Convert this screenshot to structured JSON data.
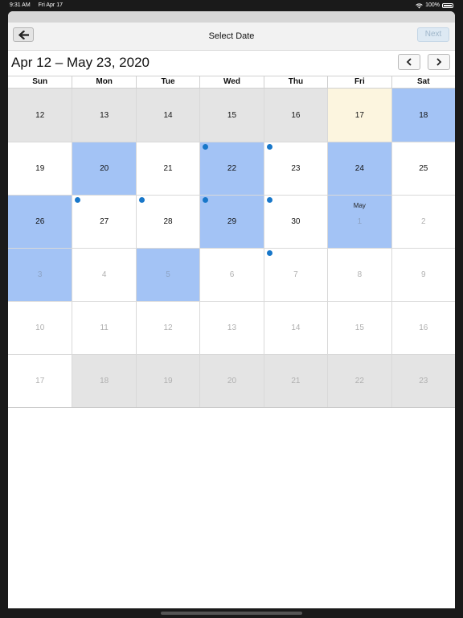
{
  "status_bar": {
    "time": "9:31 AM",
    "date": "Fri Apr 17",
    "battery": "100%",
    "icons": [
      "wifi-icon",
      "battery-icon"
    ]
  },
  "nav": {
    "title": "Select Date",
    "next_label": "Next",
    "back_icon": "arrow-left-icon"
  },
  "header": {
    "range_title": "Apr 12 – May 23, 2020",
    "prev_icon": "chevron-left-icon",
    "next_icon": "chevron-right-icon"
  },
  "weekdays": [
    "Sun",
    "Mon",
    "Tue",
    "Wed",
    "Thu",
    "Fri",
    "Sat"
  ],
  "colors": {
    "selected": "#a3c3f5",
    "past": "#e4e4e4",
    "today": "#fcf5df",
    "event_dot": "#1877c9"
  },
  "days": [
    {
      "label": "12",
      "state": "past"
    },
    {
      "label": "13",
      "state": "past"
    },
    {
      "label": "14",
      "state": "past"
    },
    {
      "label": "15",
      "state": "past"
    },
    {
      "label": "16",
      "state": "past"
    },
    {
      "label": "17",
      "state": "today"
    },
    {
      "label": "18",
      "state": "selected"
    },
    {
      "label": "19",
      "state": "normal"
    },
    {
      "label": "20",
      "state": "selected"
    },
    {
      "label": "21",
      "state": "normal"
    },
    {
      "label": "22",
      "state": "selected",
      "dot": true
    },
    {
      "label": "23",
      "state": "normal",
      "dot": true
    },
    {
      "label": "24",
      "state": "selected"
    },
    {
      "label": "25",
      "state": "normal"
    },
    {
      "label": "26",
      "state": "selected"
    },
    {
      "label": "27",
      "state": "normal",
      "dot": true
    },
    {
      "label": "28",
      "state": "normal",
      "dot": true
    },
    {
      "label": "29",
      "state": "selected",
      "dot": true
    },
    {
      "label": "30",
      "state": "normal",
      "dot": true
    },
    {
      "label": "1",
      "state": "selected",
      "muted": true,
      "month": "May"
    },
    {
      "label": "2",
      "state": "normal",
      "muted": true
    },
    {
      "label": "3",
      "state": "selected",
      "muted": true
    },
    {
      "label": "4",
      "state": "normal",
      "muted": true
    },
    {
      "label": "5",
      "state": "selected",
      "muted": true
    },
    {
      "label": "6",
      "state": "normal",
      "muted": true
    },
    {
      "label": "7",
      "state": "normal",
      "muted": true,
      "dot": true
    },
    {
      "label": "8",
      "state": "normal",
      "muted": true
    },
    {
      "label": "9",
      "state": "normal",
      "muted": true
    },
    {
      "label": "10",
      "state": "normal",
      "muted": true
    },
    {
      "label": "11",
      "state": "normal",
      "muted": true
    },
    {
      "label": "12",
      "state": "normal",
      "muted": true
    },
    {
      "label": "13",
      "state": "normal",
      "muted": true
    },
    {
      "label": "14",
      "state": "normal",
      "muted": true
    },
    {
      "label": "15",
      "state": "normal",
      "muted": true
    },
    {
      "label": "16",
      "state": "normal",
      "muted": true
    },
    {
      "label": "17",
      "state": "normal",
      "muted": true
    },
    {
      "label": "18",
      "state": "past",
      "muted": true
    },
    {
      "label": "19",
      "state": "past",
      "muted": true
    },
    {
      "label": "20",
      "state": "past",
      "muted": true
    },
    {
      "label": "21",
      "state": "past",
      "muted": true
    },
    {
      "label": "22",
      "state": "past",
      "muted": true
    },
    {
      "label": "23",
      "state": "past",
      "muted": true
    }
  ]
}
